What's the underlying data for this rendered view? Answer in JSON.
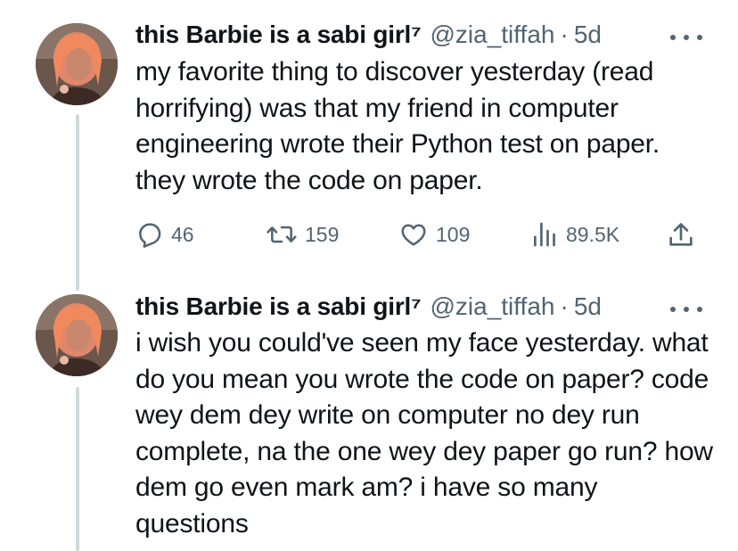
{
  "tweets": [
    {
      "author_name": "this Barbie is a sabi girl⁷",
      "handle": "@zia_tiffah",
      "separator": "·",
      "time": "5d",
      "text": "my favorite thing to discover yesterday (read horrifying) was that my friend in computer engineering wrote their Python test on paper. they wrote the code on paper.",
      "actions": {
        "replies": "46",
        "retweets": "159",
        "likes": "109",
        "views": "89.5K"
      }
    },
    {
      "author_name": "this Barbie is a sabi girl⁷",
      "handle": "@zia_tiffah",
      "separator": "·",
      "time": "5d",
      "text": "i wish you could've seen my face yesterday. what do you mean you wrote the code on paper? code wey dem dey write on computer no dey run complete, na the one wey dey paper go run? how dem go even mark am? i have so many questions"
    }
  ],
  "icons": {
    "reply": "reply-bubble-icon",
    "retweet": "retweet-icon",
    "like": "heart-icon",
    "views": "views-bar-icon",
    "share": "share-icon",
    "more": "more-dots-icon"
  },
  "colors": {
    "text": "#0f1419",
    "secondary": "#536471",
    "thread_line": "#cfd9de"
  }
}
